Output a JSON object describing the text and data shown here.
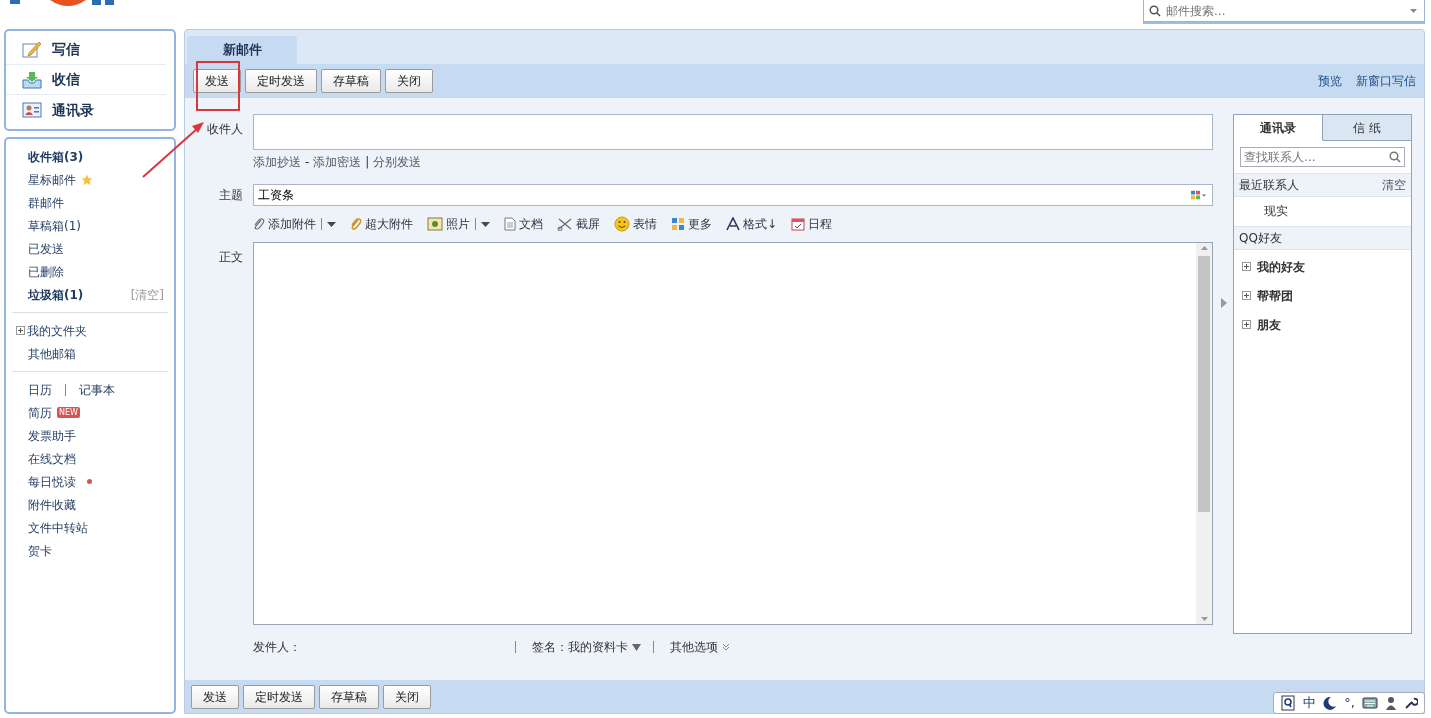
{
  "header": {
    "search": {
      "placeholder": "邮件搜索..."
    }
  },
  "sidebar": {
    "actions": [
      {
        "label": "写信",
        "kind": "compose"
      },
      {
        "label": "收信",
        "kind": "receive"
      },
      {
        "label": "通讯录",
        "kind": "contacts"
      }
    ],
    "groups": [
      [
        {
          "label": "收件箱(3)",
          "bold": true
        },
        {
          "label": "星标邮件",
          "bold": false,
          "kind": "starred"
        },
        {
          "label": "群邮件",
          "bold": false
        },
        {
          "label": "草稿箱(1)",
          "bold": false
        },
        {
          "label": "已发送",
          "bold": false
        },
        {
          "label": "已删除",
          "bold": false
        },
        {
          "label": "垃圾箱(1)",
          "bold": true,
          "action": "[清空]"
        }
      ],
      [
        {
          "label": "我的文件夹",
          "kind": "tree",
          "expanded": false
        },
        {
          "label": "其他邮箱"
        }
      ],
      [
        {
          "label": "日历",
          "second": "记事本",
          "kind": "pair"
        },
        {
          "label": "简历",
          "badge": "NEW"
        },
        {
          "label": "发票助手"
        },
        {
          "label": "在线文档"
        },
        {
          "label": "每日悦读",
          "kind": "dot"
        },
        {
          "label": "附件收藏"
        },
        {
          "label": "文件中转站"
        },
        {
          "label": "贺卡"
        }
      ]
    ]
  },
  "compose": {
    "tabs": [
      {
        "label": "新邮件",
        "selected": true
      }
    ],
    "toolbar": {
      "buttons": [
        "发送",
        "定时发送",
        "存草稿",
        "关闭"
      ],
      "links": [
        "预览",
        "新窗口写信"
      ]
    },
    "recipient": {
      "label": "收件人"
    },
    "cc_links": [
      {
        "kind": "link",
        "text": "添加抄送"
      },
      {
        "kind": "sep",
        "text": "-"
      },
      {
        "kind": "link",
        "text": "添加密送"
      },
      {
        "kind": "sep",
        "text": "|"
      },
      {
        "kind": "link",
        "text": "分别发送"
      }
    ],
    "subject": {
      "label": "主题",
      "value": "工资条"
    },
    "attach_tools": [
      {
        "label": "添加附件",
        "kind": "paperclip",
        "dropdown": true
      },
      {
        "label": "超大附件",
        "kind": "bigclip",
        "dropdown": false
      },
      {
        "label": "照片",
        "kind": "photo",
        "dropdown": true
      },
      {
        "label": "文档",
        "kind": "doc",
        "dropdown": false
      },
      {
        "label": "截屏",
        "kind": "scissors",
        "dropdown": false
      },
      {
        "label": "表情",
        "kind": "smiley",
        "dropdown": false
      },
      {
        "label": "更多",
        "kind": "grid",
        "dropdown": false
      },
      {
        "label": "格式↓",
        "kind": "font",
        "dropdown": false
      },
      {
        "label": "日程",
        "kind": "calendar",
        "dropdown": false
      }
    ],
    "body": {
      "label": "正文"
    },
    "footer": [
      {
        "kind": "text",
        "text": "发件人："
      },
      {
        "kind": "menu",
        "text": "签名：我的资料卡"
      },
      {
        "kind": "more",
        "text": "其他选项"
      }
    ],
    "bottom_buttons": [
      "发送",
      "定时发送",
      "存草稿",
      "关闭"
    ]
  },
  "contacts": {
    "tabs": [
      {
        "label": "通讯录",
        "selected": true
      },
      {
        "label": "信 纸",
        "selected": false
      }
    ],
    "search": {
      "placeholder": "查找联系人..."
    },
    "recent": {
      "title": "最近联系人",
      "action": "清空",
      "items": [
        "现实"
      ]
    },
    "qq": {
      "title": "QQ好友",
      "groups": [
        {
          "label": "我的好友",
          "expanded": false
        },
        {
          "label": "帮帮团",
          "expanded": false
        },
        {
          "label": "朋友",
          "expanded": false
        }
      ]
    }
  },
  "ime": {
    "items": [
      {
        "kind": "book"
      },
      {
        "kind": "text",
        "text": "中"
      },
      {
        "kind": "moon"
      },
      {
        "kind": "text",
        "text": "°,"
      },
      {
        "kind": "keyboard"
      },
      {
        "kind": "person"
      },
      {
        "kind": "wrench"
      }
    ]
  }
}
